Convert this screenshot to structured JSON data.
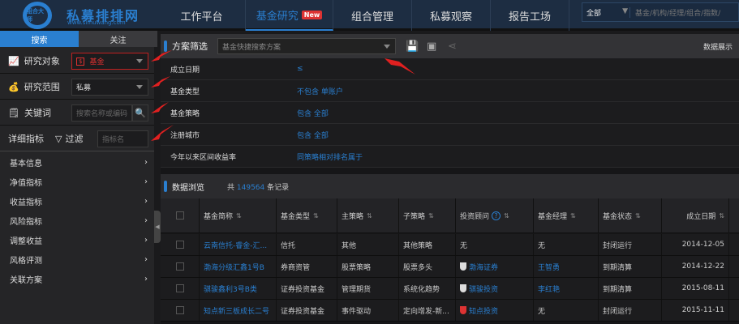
{
  "header": {
    "logo_text": "组合大师",
    "brand": "私募排排网",
    "brand_url": "www.simuwang.com",
    "nav": [
      {
        "label": "工作平台"
      },
      {
        "label": "基金研究",
        "badge": "New"
      },
      {
        "label": "组合管理"
      },
      {
        "label": "私募观察"
      },
      {
        "label": "报告工场"
      }
    ],
    "search_scope": "全部",
    "search_placeholder": "基金/机构/经理/组合/指数/"
  },
  "sidebar": {
    "tabs": [
      "搜索",
      "关注"
    ],
    "research_object_label": "研究对象",
    "research_object_value": "基金",
    "research_scope_label": "研究范围",
    "research_scope_value": "私募",
    "keyword_label": "关键词",
    "keyword_placeholder": "搜索名称或编码",
    "detail_label": "详细指标",
    "filter_label": "过滤",
    "filter_placeholder": "指标名",
    "items": [
      "基本信息",
      "净值指标",
      "收益指标",
      "风险指标",
      "调整收益",
      "风格评测",
      "关联方案"
    ]
  },
  "filters": {
    "title": "方案筛选",
    "scheme_placeholder": "基金快捷搜索方案",
    "display_label": "数据展示",
    "rows": [
      {
        "label": "成立日期",
        "value": "≤"
      },
      {
        "label": "基金类型",
        "value": "不包含 单账户"
      },
      {
        "label": "基金策略",
        "value": "包含 全部"
      },
      {
        "label": "注册城市",
        "value": "包含 全部"
      },
      {
        "label": "今年以来区间收益率",
        "value": "同策略相对排名属于"
      }
    ]
  },
  "browse": {
    "title": "数据浏览",
    "count_prefix": "共",
    "count": "149564",
    "count_suffix": "条记录",
    "columns": [
      "基金简称",
      "基金类型",
      "主策略",
      "子策略",
      "投资顾问",
      "基金经理",
      "基金状态",
      "成立日期"
    ],
    "rows": [
      [
        "云南信托-睿金-汇...",
        "信托",
        "其他",
        "其他策略",
        "无",
        "无",
        "封闭运行",
        "2014-12-05"
      ],
      [
        "渤海分级汇鑫1号B",
        "券商资管",
        "股票策略",
        "股票多头",
        "渤海证券",
        "王智勇",
        "到期清算",
        "2014-12-22"
      ],
      [
        "骐骏鑫利3号B类",
        "证券投资基金",
        "管理期货",
        "系统化趋势",
        "骐骏投资",
        "李红艳",
        "到期清算",
        "2015-08-11"
      ],
      [
        "知点新三板成长二号",
        "证券投资基金",
        "事件驱动",
        "定向增发-新...",
        "知点投资",
        "无",
        "封闭运行",
        "2015-11-11"
      ]
    ]
  },
  "colors": {
    "accent": "#2a7fd0",
    "header_bg": "#1d2d42",
    "annotation_arrow": "#e02020",
    "badge": "#d33333"
  }
}
